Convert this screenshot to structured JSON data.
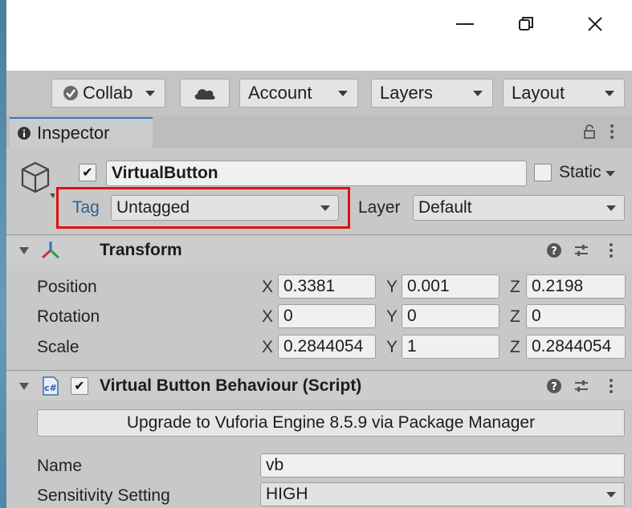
{
  "window": {
    "minimize_label": "—",
    "maximize_label": "▢",
    "close_label": "✕"
  },
  "toolbar": {
    "collab_label": "Collab",
    "account_label": "Account",
    "layers_label": "Layers",
    "layout_label": "Layout"
  },
  "tab": {
    "label": "Inspector",
    "info_glyph": "i"
  },
  "object": {
    "name": "VirtualButton",
    "static_label": "Static",
    "tag_label": "Tag",
    "tag_value": "Untagged",
    "layer_label": "Layer",
    "layer_value": "Default"
  },
  "transform": {
    "title": "Transform",
    "rows": [
      {
        "label": "Position",
        "x": "0.3381",
        "y": "0.001",
        "z": "0.2198"
      },
      {
        "label": "Rotation",
        "x": "0",
        "y": "0",
        "z": "0"
      },
      {
        "label": "Scale",
        "x": "0.2844054",
        "y": "1",
        "z": "0.2844054"
      }
    ],
    "axis_x": "X",
    "axis_y": "Y",
    "axis_z": "Z"
  },
  "script": {
    "title": "Virtual Button Behaviour (Script)",
    "upgrade_label": "Upgrade to Vuforia Engine 8.5.9 via Package Manager",
    "name_label": "Name",
    "name_value": "vb",
    "sensitivity_label": "Sensitivity Setting",
    "sensitivity_value": "HIGH"
  },
  "colors": {
    "highlight": "#e01010",
    "tab_accent": "#3a78c4"
  }
}
